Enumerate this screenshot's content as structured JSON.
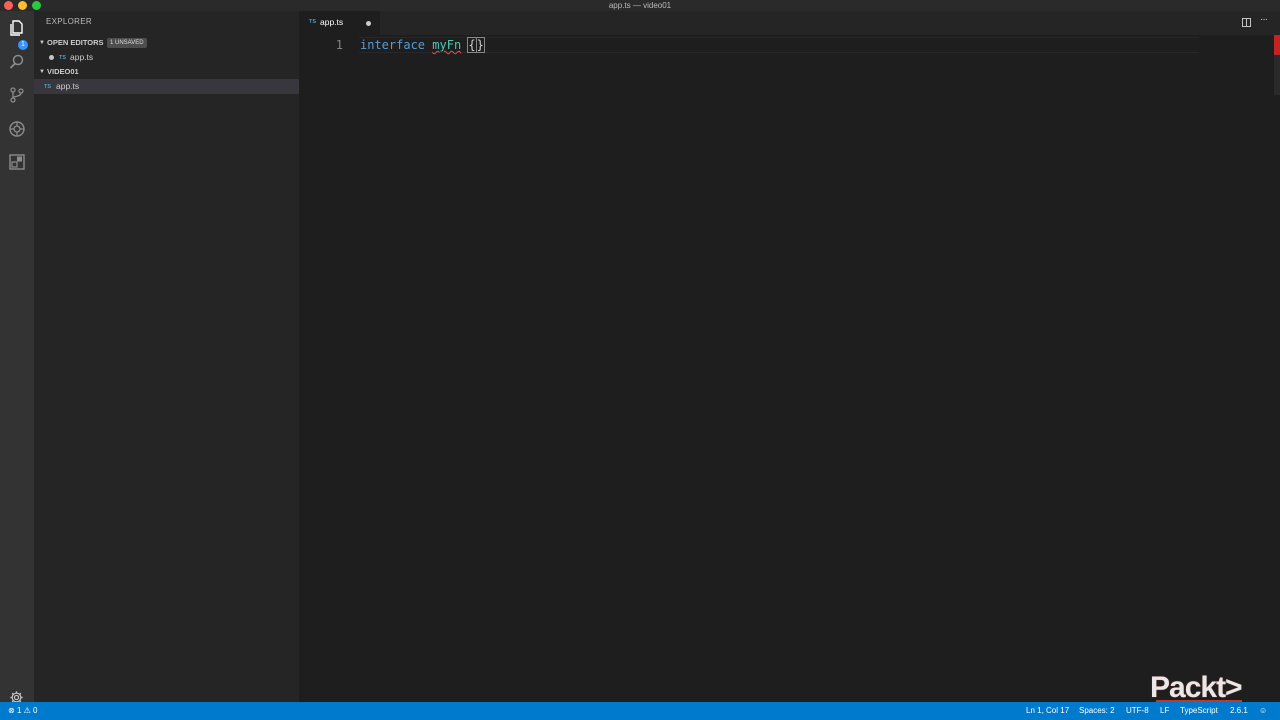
{
  "window": {
    "title": "app.ts — video01"
  },
  "activity_bar": {
    "explorer_badge": "1",
    "icons": [
      "files-icon",
      "search-icon",
      "source-control-icon",
      "debug-icon",
      "extensions-icon",
      "gear-icon"
    ]
  },
  "sidebar": {
    "title": "EXPLORER",
    "open_editors": {
      "label": "OPEN EDITORS",
      "badge": "1 UNSAVED",
      "items": [
        {
          "file_type": "TS",
          "label": "app.ts"
        }
      ]
    },
    "folder": {
      "label": "VIDEO01",
      "items": [
        {
          "file_type": "TS",
          "label": "app.ts"
        }
      ]
    }
  },
  "tabs": [
    {
      "file_type": "TS",
      "label": "app.ts",
      "dirty": true
    }
  ],
  "editor": {
    "line_number": "1",
    "code": {
      "keyword": "interface",
      "identifier": "myFn",
      "brace_open": "{",
      "brace_close": "}"
    }
  },
  "status_bar": {
    "errors": "1",
    "warnings": "0",
    "position": "Ln 1, Col 17",
    "spaces": "Spaces: 2",
    "encoding": "UTF-8",
    "eol": "LF",
    "language": "TypeScript",
    "version": "2.6.1"
  },
  "watermark": {
    "text": "Packt>"
  },
  "colors": {
    "status_bar": "#007acc",
    "keyword": "#569cd6",
    "identifier": "#4ec9b0",
    "editor_bg": "#1e1e1e",
    "sidebar_bg": "#252526"
  }
}
